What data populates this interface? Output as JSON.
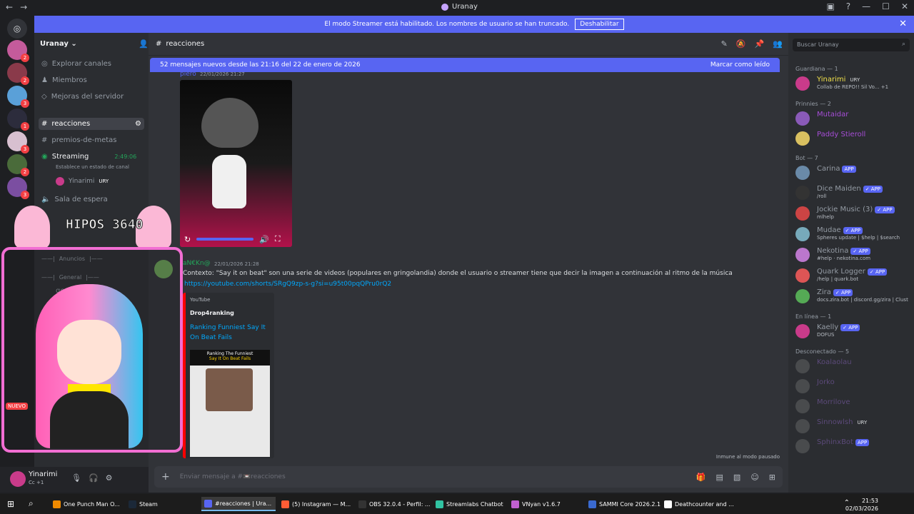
{
  "window": {
    "title": "Uranay",
    "min": "—",
    "max": "☐",
    "close": "✕",
    "back": "←",
    "forward": "→"
  },
  "banner": {
    "text": "El modo Streamer está habilitado. Los nombres de usuario se han truncado.",
    "button": "Deshabilitar",
    "close": "✕"
  },
  "server": {
    "name": "Uranay"
  },
  "sidebar": {
    "items": [
      {
        "icon": "compass-icon",
        "label": "Explorar canales"
      },
      {
        "icon": "members-icon",
        "label": "Miembros"
      },
      {
        "icon": "boost-icon",
        "label": "Mejoras del servidor"
      }
    ],
    "active_channel": "reacciones",
    "channel2": "premios-de-metas",
    "voice": {
      "name": "Streaming",
      "time": "2:49:06",
      "status": "Establece un estado de canal"
    },
    "voice_user": {
      "name": "Yinarimi",
      "badge": "URY"
    },
    "waiting": "Sala de espera",
    "cat1": "Anuncios",
    "cat2": "General",
    "general": "general"
  },
  "chat": {
    "channel": "reacciones",
    "new_messages": "52 mensajes nuevos desde las 21:16 del 22 de enero de 2026",
    "mark_read": "Marcar como leído",
    "msg1": {
      "author": "piero",
      "time": "22/01/2026 21:27"
    },
    "msg2": {
      "author": "aN€Kn@",
      "time": "22/01/2026 21:28",
      "text": "Contexto: \"Say it on beat\" son una serie de videos (populares en gringolandia) donde el usuario o streamer tiene que decir la imagen a continuación al ritmo de la música",
      "link": "https://youtube.com/shorts/SRgQ9zp-s-g?si=u95t00pqQPru0rQ2"
    },
    "embed": {
      "provider": "YouTube",
      "author": "Drop4ranking",
      "title": "Ranking Funniest Say It On Beat Fails",
      "thumb_head": "Ranking The Funniest",
      "thumb_sub": "Say It On Beat Fails"
    },
    "paused": "Inmune al modo pausado",
    "placeholder": "Enviar mensaje a #📼reacciones"
  },
  "members": {
    "search": "Buscar Uranay",
    "groups": [
      {
        "label": "Guardiana — 1",
        "list": [
          {
            "name": "Yinarimi",
            "tag": "URY",
            "status": "Collab de REPO!! Sil Vo... +1",
            "color": "#f0e04a"
          }
        ]
      },
      {
        "label": "Prinnies — 2",
        "list": [
          {
            "name": "Mutaidar",
            "tag": "",
            "status": "",
            "color": "#a64dd6"
          },
          {
            "name": "Paddy Stieroll",
            "tag": "",
            "status": "",
            "color": "#a64dd6"
          }
        ]
      },
      {
        "label": "Bot — 7",
        "list": [
          {
            "name": "Carina",
            "tag": "APP",
            "status": "",
            "color": "#949ba4"
          },
          {
            "name": "Dice Maiden",
            "tag": "✓ APP",
            "status": "/roll",
            "color": "#949ba4"
          },
          {
            "name": "Jockie Music (3)",
            "tag": "✓ APP",
            "status": "mlhelp",
            "color": "#949ba4"
          },
          {
            "name": "Mudae",
            "tag": "✓ APP",
            "status": "Spheres update | $help | $search",
            "color": "#949ba4"
          },
          {
            "name": "Nekotina",
            "tag": "✓ APP",
            "status": "#help · nekotina.com",
            "color": "#949ba4"
          },
          {
            "name": "Quark Logger",
            "tag": "✓ APP",
            "status": "/help | quark.bot",
            "color": "#949ba4"
          },
          {
            "name": "Zira",
            "tag": "✓ APP",
            "status": "docs.zira.bot | discord.gg/zira | Clust",
            "color": "#949ba4"
          }
        ]
      },
      {
        "label": "En línea — 1",
        "list": [
          {
            "name": "Kaelly",
            "tag": "✓ APP",
            "status": "DOFUS",
            "color": "#949ba4"
          }
        ]
      },
      {
        "label": "Desconectado — 5",
        "list": [
          {
            "name": "Koalaolau",
            "tag": "",
            "status": "",
            "color": "#5c4a7a"
          },
          {
            "name": "Jorko",
            "tag": "",
            "status": "",
            "color": "#5c4a7a"
          },
          {
            "name": "Morrilove",
            "tag": "",
            "status": "",
            "color": "#5c4a7a"
          },
          {
            "name": "Sinnowlsh",
            "tag": "URY",
            "status": "",
            "color": "#5c4a7a"
          },
          {
            "name": "SphinxBot",
            "tag": "APP",
            "status": "",
            "color": "#5c4a7a"
          }
        ]
      }
    ]
  },
  "user": {
    "name": "Yinarimi",
    "status": "Cc +1"
  },
  "overlay": {
    "text": "HIPOS 3640",
    "badge": "NUEVO"
  },
  "taskbar": {
    "items": [
      {
        "label": "One Punch Man O...",
        "icon": "vlc-icon",
        "active": false
      },
      {
        "label": "Steam",
        "icon": "steam-icon",
        "active": false
      },
      {
        "label": "#reacciones | Ura...",
        "icon": "discord-icon",
        "active": true
      },
      {
        "label": "(5) Instagram — M...",
        "icon": "firefox-icon",
        "active": false
      },
      {
        "label": "OBS 32.0.4 - Perfil: ...",
        "icon": "obs-icon",
        "active": false
      },
      {
        "label": "Streamlabs Chatbot",
        "icon": "streamlabs-icon",
        "active": false
      },
      {
        "label": "VNyan v1.6.7",
        "icon": "vnyan-icon",
        "active": false
      },
      {
        "label": "SAMMI Core 2026.2.1",
        "icon": "sammi-icon",
        "active": false
      },
      {
        "label": "Deathcounter and ...",
        "icon": "deathcounter-icon",
        "active": false
      }
    ],
    "time": "21:53",
    "date": "02/03/2026"
  }
}
